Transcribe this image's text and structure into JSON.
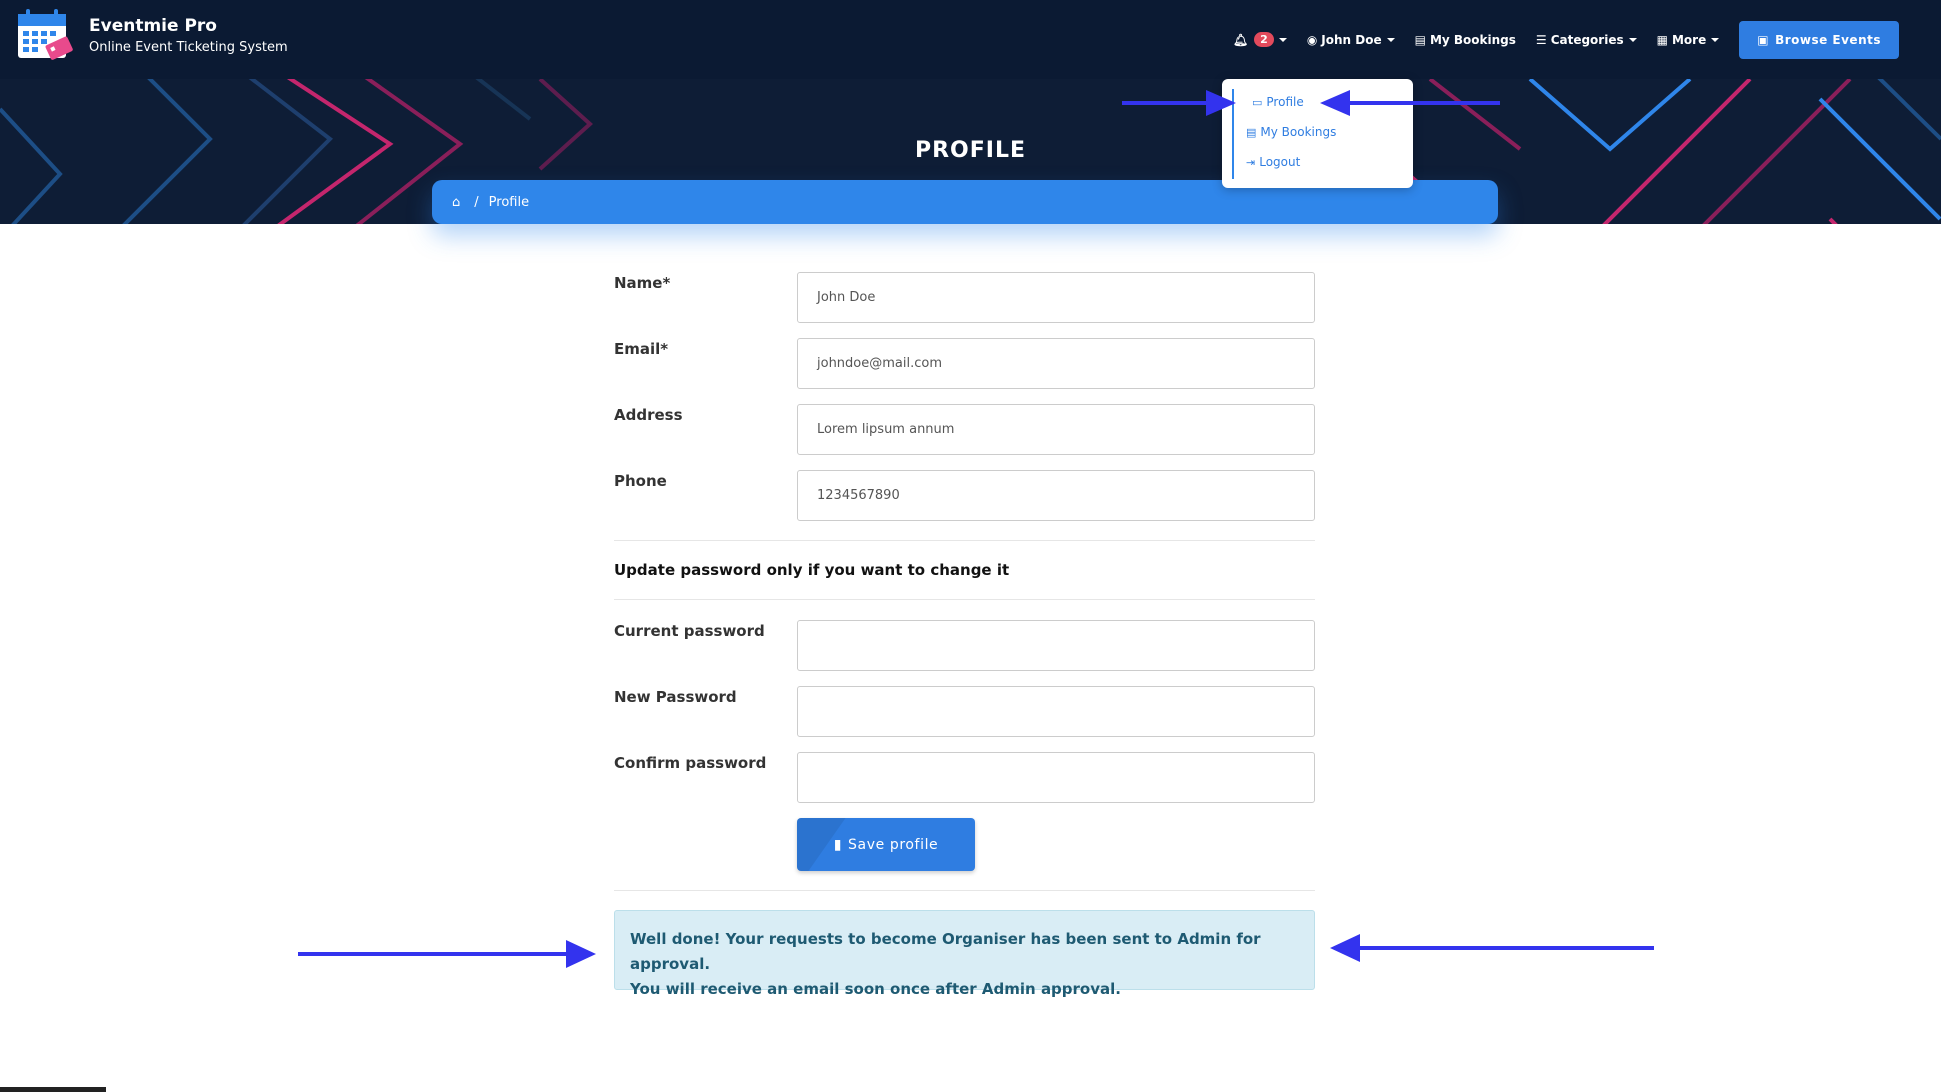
{
  "brand": {
    "name": "Eventmie Pro",
    "tagline": "Online Event Ticketing System"
  },
  "nav": {
    "notifications_count": "2",
    "user_name": "John Doe",
    "my_bookings": "My Bookings",
    "categories": "Categories",
    "more": "More",
    "browse_events": "Browse Events"
  },
  "dropdown": {
    "items": [
      {
        "label": "Profile"
      },
      {
        "label": "My Bookings"
      },
      {
        "label": "Logout"
      }
    ]
  },
  "page": {
    "title": "PROFILE"
  },
  "breadcrumb": {
    "separator": "/",
    "current": "Profile"
  },
  "form": {
    "name_label": "Name*",
    "name_value": "John Doe",
    "email_label": "Email*",
    "email_value": "johndoe@mail.com",
    "address_label": "Address",
    "address_value": "Lorem lipsum annum",
    "phone_label": "Phone",
    "phone_value": "1234567890",
    "password_section": "Update password only if you want to change it",
    "current_password_label": "Current password",
    "new_password_label": "New Password",
    "confirm_password_label": "Confirm password",
    "save_label": "Save profile"
  },
  "alert": {
    "line1": "Well done! Your requests to become Organiser has been sent to Admin for approval.",
    "line2": "You will receive an email soon once after Admin approval."
  },
  "colors": {
    "navbar": "#0b1a33",
    "accent": "#2f7de1",
    "badge": "#e34a5c",
    "arrow": "#3333ee",
    "alert_bg": "#d9edf5"
  }
}
